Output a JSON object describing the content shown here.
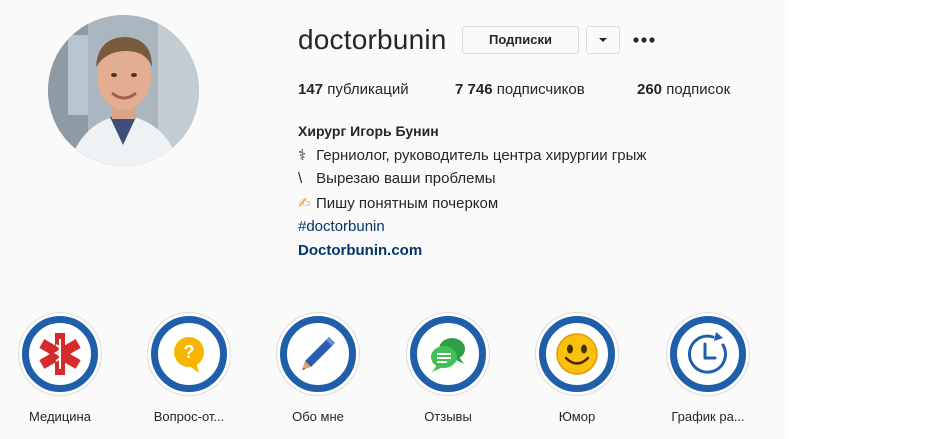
{
  "profile": {
    "username": "doctorbunin",
    "following_button_label": "Подписки",
    "dropdown_icon": "caret-down-icon",
    "more_icon": "ellipsis-icon",
    "avatar": "profile-photo"
  },
  "stats": {
    "posts_count": "147",
    "posts_label": " публикаций",
    "followers_count": "7 746",
    "followers_label": " подписчиков",
    "following_count": "260",
    "following_label": " подписок"
  },
  "bio": {
    "name": "Хирург Игорь Бунин",
    "line1_glyph": "⚕",
    "line1": " Герниолог, руководитель центра хирургии грыж",
    "line2_glyph": "\\",
    "line2": " Вырезаю ваши проблемы",
    "line3_glyph": "✍",
    "line3": "Пишу понятным почерком",
    "hashtag": "#doctorbunin",
    "website": "Doctorbunin.com"
  },
  "highlights": [
    {
      "label": "Медицина",
      "icon": "star-of-life-icon"
    },
    {
      "label": "Вопрос-от...",
      "icon": "question-bubble-icon"
    },
    {
      "label": "Обо мне",
      "icon": "pen-icon"
    },
    {
      "label": "Отзывы",
      "icon": "chat-bubbles-icon"
    },
    {
      "label": "Юмор",
      "icon": "smiley-icon"
    },
    {
      "label": "График ра...",
      "icon": "clock-icon"
    }
  ],
  "colors": {
    "ring_blue": "#1f5ea8",
    "link_blue": "#00376b",
    "text": "#262626",
    "background": "#fafafa"
  }
}
